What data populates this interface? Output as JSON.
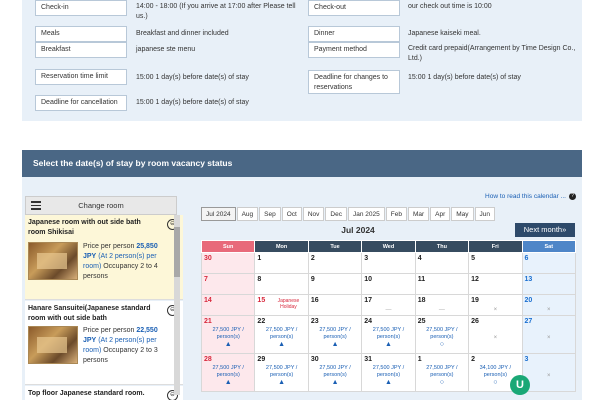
{
  "info": {
    "checkin_label": "Check-in",
    "checkin_value": "14:00 - 18:00 (If you arrive at 17:00 after Please tell us.)",
    "checkout_label": "Check-out",
    "checkout_value": "our check out time is 10:00",
    "meals_label": "Meals",
    "meals_value": "Breakfast and dinner included",
    "dinner_label": "Dinner",
    "dinner_value": "Japanese kaiseki meal.",
    "breakfast_label": "Breakfast",
    "breakfast_value": "japanese ste menu",
    "payment_label": "Payment method",
    "payment_value": "Credit card prepaid(Arrangement by Time Design Co., Ltd.)",
    "reservation_time_label": "Reservation time limit",
    "reservation_time_value": "15:00 1 day(s) before date(s) of stay",
    "deadline_changes_label": "Deadline for changes to reservations",
    "deadline_changes_value": "15:00 1 day(s) before date(s) of stay",
    "deadline_cancel_label": "Deadline for cancellation",
    "deadline_cancel_value": "15:00 1 day(s) before date(s) of stay"
  },
  "section": {
    "title": "Select the date(s) of stay by room vacancy status"
  },
  "sidebar": {
    "change_room_label": "Change room",
    "rooms": [
      {
        "title": "Japanese room with out side bath room Shikisai",
        "price_prefix": "Price per person",
        "price": "25,850",
        "currency": "JPY",
        "price_note": "(At 2 person(s) per room)",
        "occupancy": "Occupancy 2 to 4 persons"
      },
      {
        "title": "Hanare Sansuitei(Japanese standard room with out side bath",
        "price_prefix": "Price per person",
        "price": "22,550",
        "currency": "JPY",
        "price_note": "(At 2 person(s) per room)",
        "occupancy": "Occupancy 2 to 3 persons"
      },
      {
        "title": "Top floor Japanese standard room."
      }
    ]
  },
  "calendar": {
    "help_link": "How to read this calendar",
    "help_icon": "?",
    "month_tabs": [
      "Jul 2024",
      "Aug",
      "Sep",
      "Oct",
      "Nov",
      "Dec",
      "Jan 2025",
      "Feb",
      "Mar",
      "Apr",
      "May",
      "Jun"
    ],
    "next_month": "Next month",
    "title": "Jul 2024",
    "weekdays": [
      "Sun",
      "Mon",
      "Tue",
      "Wed",
      "Thu",
      "Fri",
      "Sat"
    ],
    "weeks": [
      [
        "30",
        "1",
        "2",
        "3",
        "4",
        "5",
        "6"
      ],
      [
        "7",
        "8",
        "9",
        "10",
        "11",
        "12",
        "13"
      ],
      [
        "14",
        "15",
        "16",
        "17",
        "18",
        "19",
        "20"
      ],
      [
        "21",
        "22",
        "23",
        "24",
        "25",
        "26",
        "27"
      ],
      [
        "28",
        "29",
        "30",
        "31",
        "1",
        "2",
        "3"
      ]
    ],
    "holiday_label": "Japanese Holiday",
    "price_text": "27,500 JPY / person(s)",
    "price_text_alt": "34,100 JPY / person(s)",
    "symbol_tri": "▲",
    "symbol_circle": "○",
    "symbol_x": "×",
    "symbol_dash": "—"
  },
  "chat": {
    "label": "U"
  }
}
